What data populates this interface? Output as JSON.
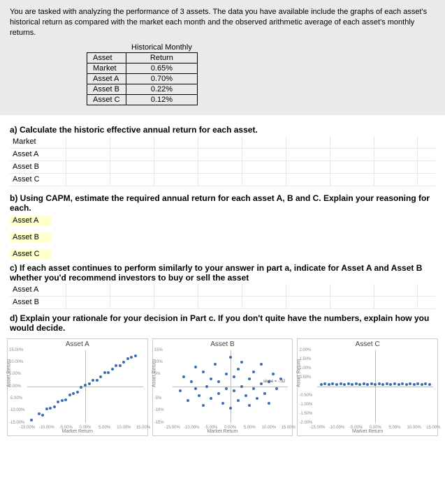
{
  "intro": "You are tasked with analyzing the performance of 3 assets.  The data you have available include the graphs of each asset's historical return as compared with the market each month and the observed arithmetic average of each asset's monthly returns.",
  "table": {
    "col1": "Asset",
    "col2_line1": "Historical Monthly",
    "col2_line2": "Return",
    "rows": [
      {
        "name": "Market",
        "value": "0.65%"
      },
      {
        "name": "Asset A",
        "value": "0.70%"
      },
      {
        "name": "Asset B",
        "value": "0.22%"
      },
      {
        "name": "Asset C",
        "value": "0.12%"
      }
    ]
  },
  "q_a": "a) Calculate the historic effective annual return for each asset.",
  "a_labels": [
    "Market",
    "Asset A",
    "Asset B",
    "Asset C"
  ],
  "q_b": "b)  Using CAPM, estimate the required annual return for each asset A, B and C.  Explain your reasoning for each.",
  "b_labels": [
    "Asset A",
    "Asset B",
    "Asset C"
  ],
  "q_c": "c) If each asset continues to perform similarly to your answer in part a, indicate for Asset A and Asset B whether you'd recommend investors to buy or sell the asset",
  "c_labels": [
    "Asset A",
    "Asset B"
  ],
  "q_d": "d) Explain your rationale for your decision in Part c.  If you don't quite have the numbers, explain how you would decide.",
  "chart_common": {
    "ylabel": "Asset Return",
    "xlabel": "Market Return"
  },
  "chart_data": [
    {
      "type": "scatter",
      "title": "Asset A",
      "xlabel": "Market Return",
      "ylabel": "Asset Return",
      "xlim_pct": [
        -15,
        15
      ],
      "ylim_pct": [
        -15,
        15
      ],
      "x_ticks": [
        "-15.00%",
        "-10.00%",
        "-5.00%",
        "0.00%",
        "5.00%",
        "10.00%",
        "15.00%"
      ],
      "y_ticks": [
        "15.00%",
        "10.00%",
        "5.00%",
        "0.00%",
        "-5.00%",
        "-10.00%",
        "-15.00%"
      ],
      "approx_slope": 1.0,
      "points_pct": [
        [
          -14,
          -14
        ],
        [
          -12,
          -11.5
        ],
        [
          -11,
          -12
        ],
        [
          -10,
          -9.5
        ],
        [
          -9,
          -9
        ],
        [
          -8,
          -8.5
        ],
        [
          -7,
          -6.5
        ],
        [
          -6,
          -6
        ],
        [
          -5,
          -5.5
        ],
        [
          -4,
          -3.5
        ],
        [
          -3,
          -3
        ],
        [
          -2,
          -2.5
        ],
        [
          -1,
          -0.5
        ],
        [
          0,
          0.5
        ],
        [
          1,
          1
        ],
        [
          2,
          2.5
        ],
        [
          3,
          2.5
        ],
        [
          4,
          4
        ],
        [
          5,
          5.5
        ],
        [
          6,
          5.5
        ],
        [
          7,
          7
        ],
        [
          8,
          8.5
        ],
        [
          9,
          8.5
        ],
        [
          10,
          10
        ],
        [
          11,
          11.5
        ],
        [
          12,
          12
        ],
        [
          13,
          12.5
        ]
      ]
    },
    {
      "type": "scatter",
      "title": "Asset B",
      "xlabel": "Market Return",
      "ylabel": "Asset Return",
      "xlim_pct": [
        -15,
        15
      ],
      "ylim_pct": [
        -15,
        15
      ],
      "x_ticks": [
        "-15.00%",
        "-10.00%",
        "-5.00%",
        "0.00%",
        "5.00%",
        "10.00%",
        "15.00%"
      ],
      "y_ticks": [
        "15%",
        "10%",
        "5%",
        "",
        "-5%",
        "-10%",
        "-15%"
      ],
      "slope_note": "slope = -.02",
      "approx_slope": -0.02,
      "points_pct": [
        [
          -13,
          -2
        ],
        [
          -12,
          4
        ],
        [
          -11,
          -6
        ],
        [
          -10,
          2
        ],
        [
          -9,
          -1
        ],
        [
          -9,
          8
        ],
        [
          -8,
          -4
        ],
        [
          -7,
          6
        ],
        [
          -7,
          -8
        ],
        [
          -6,
          0
        ],
        [
          -5,
          3
        ],
        [
          -5,
          -5
        ],
        [
          -4,
          9
        ],
        [
          -3,
          -3
        ],
        [
          -3,
          2
        ],
        [
          -2,
          -7
        ],
        [
          -1,
          5
        ],
        [
          -1,
          -1
        ],
        [
          0,
          12
        ],
        [
          0,
          -9
        ],
        [
          1,
          4
        ],
        [
          1,
          -2
        ],
        [
          2,
          7
        ],
        [
          2,
          -6
        ],
        [
          3,
          0
        ],
        [
          3,
          10
        ],
        [
          4,
          -4
        ],
        [
          5,
          3
        ],
        [
          5,
          -8
        ],
        [
          6,
          6
        ],
        [
          6,
          -1
        ],
        [
          7,
          -5
        ],
        [
          8,
          1
        ],
        [
          8,
          9
        ],
        [
          9,
          -3
        ],
        [
          10,
          2
        ],
        [
          10,
          -7
        ],
        [
          11,
          5
        ],
        [
          12,
          -1
        ],
        [
          13,
          3
        ]
      ]
    },
    {
      "type": "scatter",
      "title": "Asset C",
      "xlabel": "Market Return",
      "ylabel": "Asset Return",
      "xlim_pct": [
        -15,
        15
      ],
      "ylim_pct": [
        -2,
        2
      ],
      "x_ticks": [
        "-15.00%",
        "-10.00%",
        "-5.00%",
        "0.00%",
        "5.00%",
        "10.00%",
        "15.00%"
      ],
      "y_ticks": [
        "2.00%",
        "1.50%",
        "1.00%",
        "0.50%",
        "",
        "-0.50%",
        "-1.00%",
        "-1.50%",
        "-2.00%"
      ],
      "approx_slope": 0.0,
      "points_pct": [
        [
          -14,
          0.1
        ],
        [
          -13,
          0.15
        ],
        [
          -12,
          0.1
        ],
        [
          -11,
          0.12
        ],
        [
          -10,
          0.1
        ],
        [
          -9,
          0.13
        ],
        [
          -8,
          0.1
        ],
        [
          -7,
          0.15
        ],
        [
          -6,
          0.1
        ],
        [
          -5,
          0.12
        ],
        [
          -4,
          0.1
        ],
        [
          -3,
          0.15
        ],
        [
          -2,
          0.1
        ],
        [
          -1,
          0.12
        ],
        [
          0,
          0.1
        ],
        [
          1,
          0.13
        ],
        [
          2,
          0.1
        ],
        [
          3,
          0.15
        ],
        [
          4,
          0.1
        ],
        [
          5,
          0.12
        ],
        [
          6,
          0.1
        ],
        [
          7,
          0.14
        ],
        [
          8,
          0.1
        ],
        [
          9,
          0.12
        ],
        [
          10,
          0.1
        ],
        [
          11,
          0.13
        ],
        [
          12,
          0.1
        ],
        [
          13,
          0.12
        ],
        [
          14,
          0.1
        ]
      ]
    }
  ]
}
